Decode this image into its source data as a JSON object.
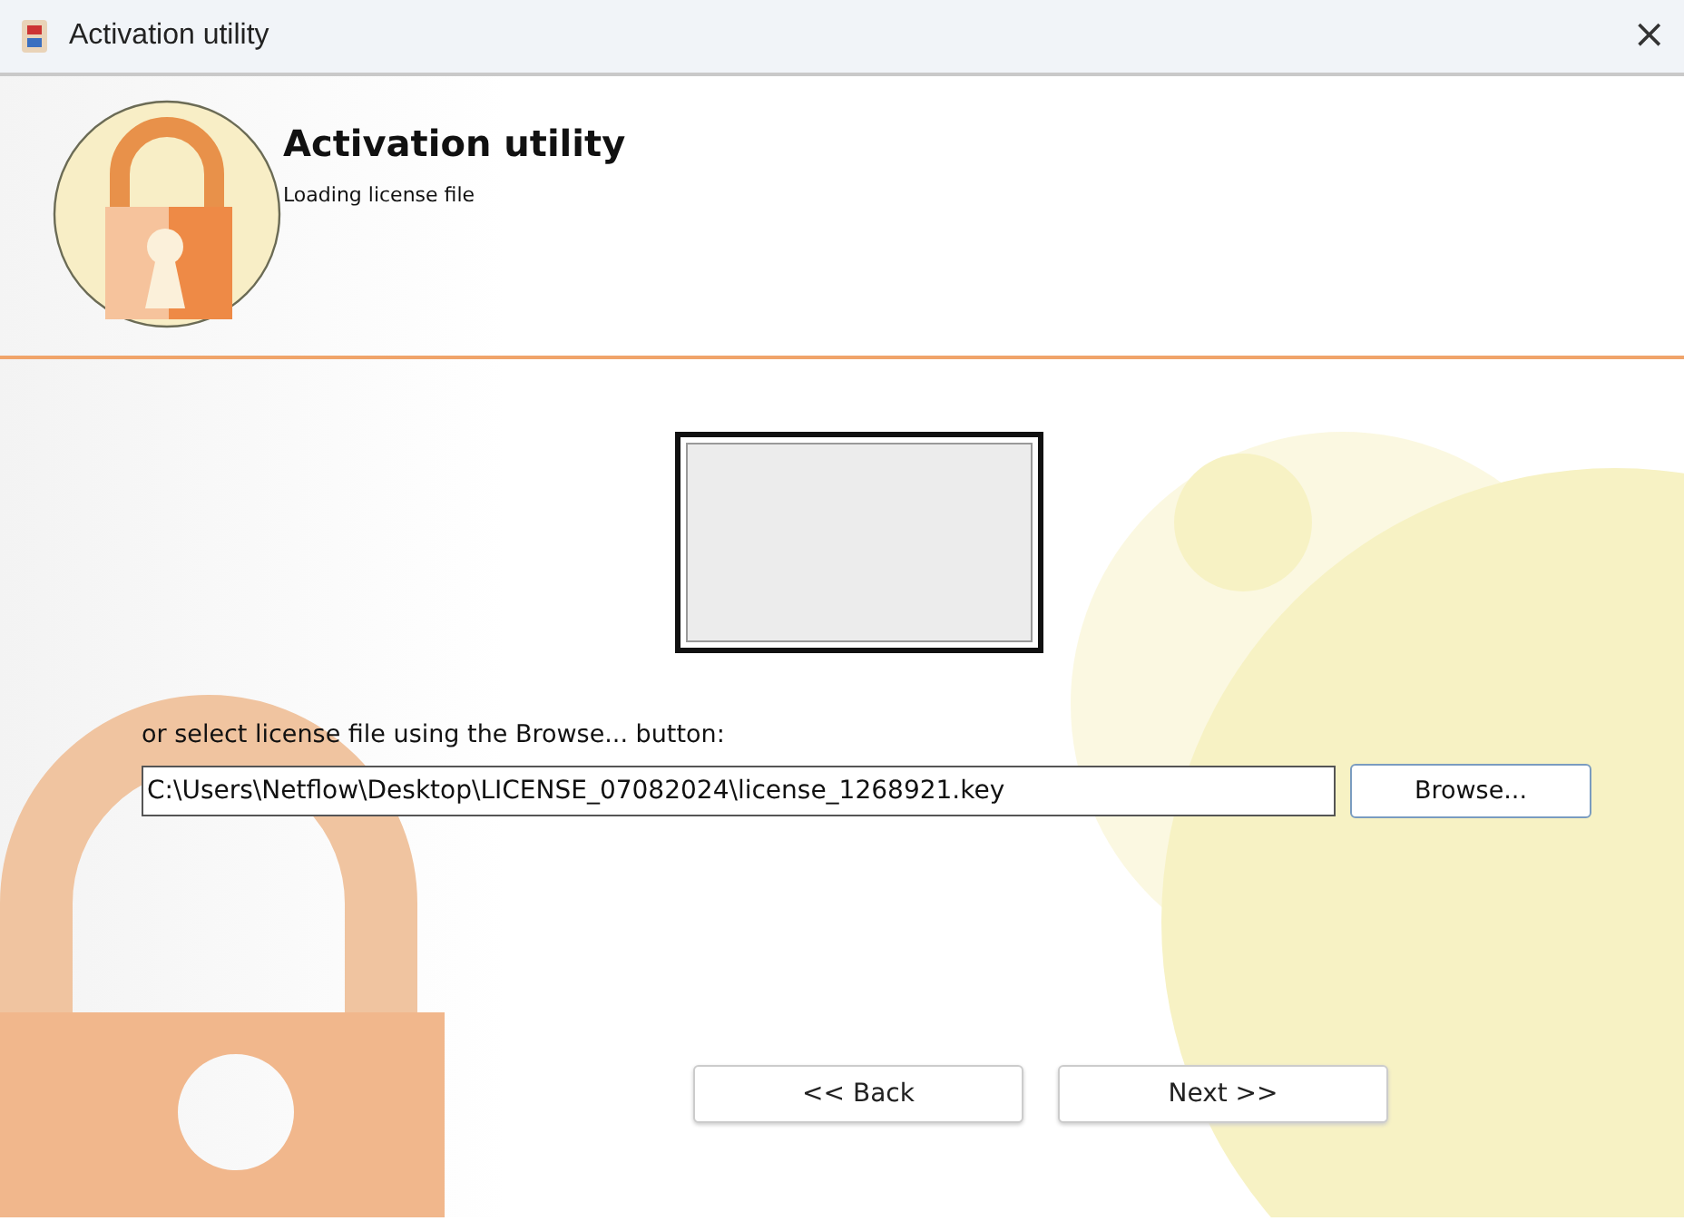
{
  "window": {
    "title": "Activation utility",
    "close": "×"
  },
  "header": {
    "title": "Activation utility",
    "subtitle": "Loading license file"
  },
  "file_prompt": "or select license file using the Browse... button:",
  "file_field": {
    "value": "C:\\Users\\Netflow\\Desktop\\LICENSE_07082024\\license_1268921.key"
  },
  "browse_button": "Browse...",
  "buttons": [
    "<< Back",
    "Next >>"
  ]
}
